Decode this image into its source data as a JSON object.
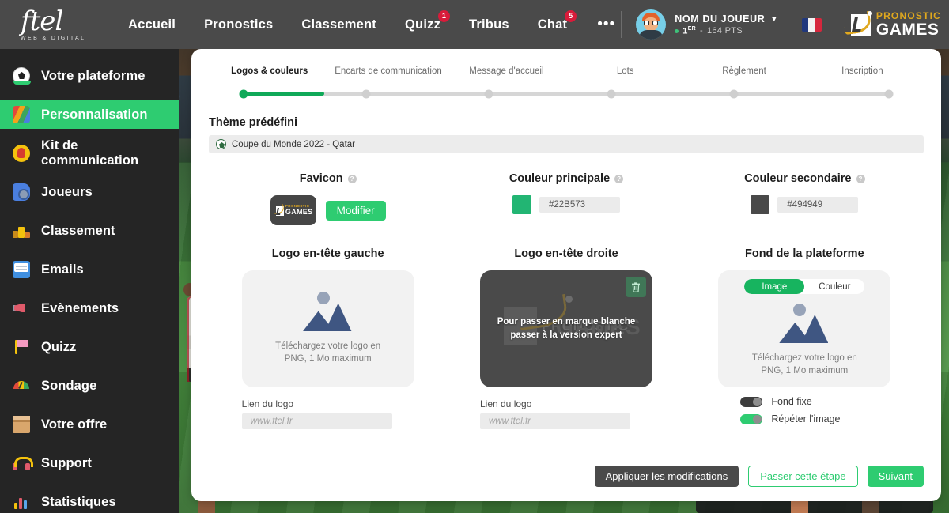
{
  "brand": {
    "logo_mark": "ftel",
    "logo_sub": "WEB & DIGITAL"
  },
  "topnav": {
    "items": [
      {
        "label": "Accueil",
        "badge": ""
      },
      {
        "label": "Pronostics",
        "badge": ""
      },
      {
        "label": "Classement",
        "badge": ""
      },
      {
        "label": "Quizz",
        "badge": "1"
      },
      {
        "label": "Tribus",
        "badge": ""
      },
      {
        "label": "Chat",
        "badge": "5"
      }
    ],
    "more": "•••",
    "player": {
      "name": "NOM DU JOUEUR",
      "caret": "▼",
      "rank": "1",
      "rank_sup": "ER",
      "separator": "-",
      "points": "164 PTS"
    },
    "flag": "france-flag",
    "product_logo": {
      "top": "PRONOSTIC",
      "bottom": "GAMES"
    }
  },
  "sidebar": {
    "items": [
      {
        "label": "Votre plateforme",
        "icon": "football-icon",
        "active": false
      },
      {
        "label": "Personnalisation",
        "icon": "palette-icon",
        "active": true
      },
      {
        "label": "Kit de communication",
        "icon": "microphone-icon",
        "active": false
      },
      {
        "label": "Joueurs",
        "icon": "whistle-icon",
        "active": false
      },
      {
        "label": "Classement",
        "icon": "podium-icon",
        "active": false
      },
      {
        "label": "Emails",
        "icon": "mail-icon",
        "active": false
      },
      {
        "label": "Evènements",
        "icon": "megaphone-icon",
        "active": false
      },
      {
        "label": "Quizz",
        "icon": "flag-icon",
        "active": false
      },
      {
        "label": "Sondage",
        "icon": "gauge-icon",
        "active": false
      },
      {
        "label": "Votre offre",
        "icon": "package-icon",
        "active": false
      },
      {
        "label": "Support",
        "icon": "headset-icon",
        "active": false
      },
      {
        "label": "Statistiques",
        "icon": "bar-chart-icon",
        "active": false
      }
    ]
  },
  "stepper": {
    "steps": [
      {
        "label": "Logos & couleurs",
        "active": true,
        "done": true
      },
      {
        "label": "Encarts de communication",
        "active": false,
        "done": false
      },
      {
        "label": "Message d'accueil",
        "active": false,
        "done": false
      },
      {
        "label": "Lots",
        "active": false,
        "done": false
      },
      {
        "label": "Règlement",
        "active": false,
        "done": false
      },
      {
        "label": "Inscription",
        "active": false,
        "done": false
      }
    ],
    "progress_percent": 13
  },
  "theme": {
    "title": "Thème prédéfini",
    "selected": "Coupe du Monde 2022 - Qatar"
  },
  "favicon": {
    "title": "Favicon",
    "help": "?",
    "button": "Modifier",
    "logo_top": "PRONOSTIC",
    "logo_bottom": "GAMES"
  },
  "primary_color": {
    "title": "Couleur principale",
    "help": "?",
    "value": "#22B573",
    "swatch": "#22B573"
  },
  "secondary_color": {
    "title": "Couleur secondaire",
    "help": "?",
    "value": "#494949",
    "swatch": "#494949"
  },
  "logo_left": {
    "title": "Logo en-tête gauche",
    "upload_text": "Téléchargez votre logo en\nPNG, 1 Mo maximum",
    "link_label": "Lien du logo",
    "link_placeholder": "www.ftel.fr",
    "link_value": ""
  },
  "logo_right": {
    "title": "Logo en-tête droite",
    "overlay_text": "Pour passer en marque blanche\npasser à la version expert",
    "watermark_top": "PRONOSTIC",
    "watermark_bottom": "GAMES",
    "link_label": "Lien du logo",
    "link_placeholder": "www.ftel.fr",
    "link_value": ""
  },
  "background": {
    "title": "Fond de la plateforme",
    "tabs": [
      {
        "label": "Image",
        "active": true
      },
      {
        "label": "Couleur",
        "active": false
      }
    ],
    "upload_text": "Téléchargez votre logo en\nPNG, 1 Mo maximum",
    "toggles": [
      {
        "label": "Fond fixe",
        "on": false
      },
      {
        "label": "Répéter l'image",
        "on": true
      }
    ]
  },
  "footer": {
    "apply": "Appliquer les modifications",
    "skip": "Passer cette étape",
    "next": "Suivant"
  },
  "colors": {
    "accent_green": "#2ecc71",
    "progress_green": "#0fa958",
    "nav_bar": "#4a4a4a",
    "sidebar": "#252525",
    "badge_red": "#d91b3a",
    "gold": "#e0a81e"
  }
}
